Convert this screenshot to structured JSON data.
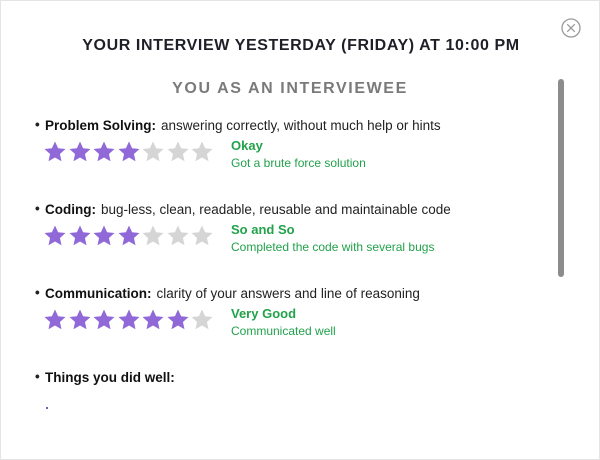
{
  "header": {
    "title": "YOUR INTERVIEW YESTERDAY (FRIDAY) AT 10:00 PM"
  },
  "section": {
    "title": "YOU AS AN INTERVIEWEE"
  },
  "colors": {
    "star_filled": "#9068d8",
    "star_empty": "#d5d5d5",
    "rating_text": "#22a24b"
  },
  "criteria": [
    {
      "name": "Problem Solving:",
      "description": "answering correctly, without much help or hints",
      "rating": 4,
      "max_rating": 7,
      "rating_label": "Okay",
      "rating_comment": "Got a brute force solution"
    },
    {
      "name": "Coding:",
      "description": "bug-less, clean, readable, reusable and maintainable code",
      "rating": 4,
      "max_rating": 7,
      "rating_label": "So and So",
      "rating_comment": "Completed the code with several bugs"
    },
    {
      "name": "Communication:",
      "description": "clarity of your answers and line of reasoning",
      "rating": 6,
      "max_rating": 7,
      "rating_label": "Very Good",
      "rating_comment": "Communicated well"
    }
  ],
  "things_well": {
    "label": "Things you did well:"
  },
  "icons": {
    "close": "close-circle-icon",
    "star": "star-icon",
    "bullet": "bullet-dot"
  }
}
